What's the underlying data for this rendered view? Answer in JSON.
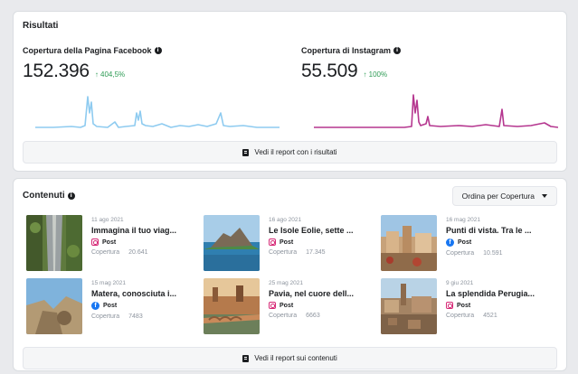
{
  "results": {
    "title": "Risultati",
    "facebook": {
      "label": "Copertura della Pagina Facebook",
      "value": "152.396",
      "change": "↑ 404,5%",
      "color": "#8ecbf0"
    },
    "instagram": {
      "label": "Copertura di Instagram",
      "value": "55.509",
      "change": "↑ 100%",
      "color": "#b5368f"
    },
    "report_label": "Vedi il report con i risultati"
  },
  "contents": {
    "title": "Contenuti",
    "sort_label": "Ordina per Copertura",
    "reach_label": "Copertura",
    "post_type_label": "Post",
    "report_label": "Vedi il report sui contenuti",
    "posts": [
      {
        "date": "11 ago 2021",
        "title": "Immagina il tuo viag...",
        "platform": "instagram",
        "reach": "20.641"
      },
      {
        "date": "16 ago 2021",
        "title": "Le Isole Eolie, sette ...",
        "platform": "instagram",
        "reach": "17.345"
      },
      {
        "date": "16 mag 2021",
        "title": "Punti di vista. Tra le ...",
        "platform": "facebook",
        "reach": "10.591"
      },
      {
        "date": "15 mag 2021",
        "title": "Matera, conosciuta i...",
        "platform": "facebook",
        "reach": "7483"
      },
      {
        "date": "25 mag 2021",
        "title": "Pavia, nel cuore dell...",
        "platform": "instagram",
        "reach": "6663"
      },
      {
        "date": "9 giu 2021",
        "title": "La splendida Perugia...",
        "platform": "instagram",
        "reach": "4521"
      }
    ]
  }
}
